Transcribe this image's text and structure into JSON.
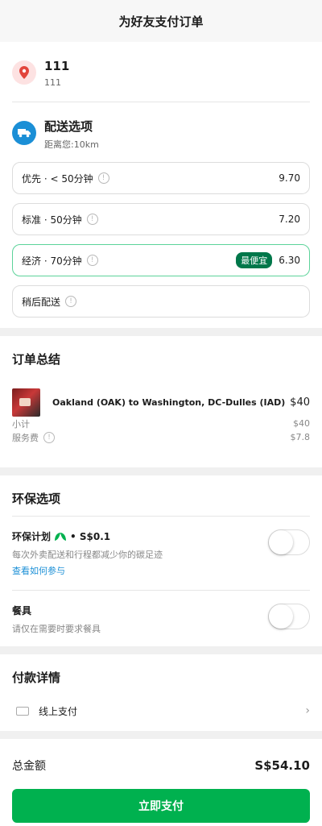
{
  "header": {
    "title": "为好友支付订单"
  },
  "address": {
    "name": "111",
    "detail": "111"
  },
  "delivery": {
    "title": "配送选项",
    "distance": "距离您:10km",
    "options": [
      {
        "label": "优先 · < 50分钟",
        "price": "9.70"
      },
      {
        "label": "标准 · 50分钟",
        "price": "7.20"
      },
      {
        "label": "经济 · 70分钟",
        "price": "6.30",
        "badge": "最便宜"
      },
      {
        "label": "稍后配送"
      }
    ]
  },
  "order": {
    "title": "订单总结",
    "item_name": "Oakland (OAK) to Washington, DC-Dulles (IAD)",
    "item_price": "$40",
    "subtotal_label": "小计",
    "subtotal_value": "$40",
    "fee_label": "服务费",
    "fee_value": "$7.8"
  },
  "eco": {
    "title": "环保选项",
    "plan_title": "环保计划",
    "plan_price": "• S$0.1",
    "plan_desc": "每次外卖配送和行程都减少你的碳足迹",
    "plan_link": "查看如何参与",
    "cutlery_title": "餐具",
    "cutlery_desc": "请仅在需要时要求餐具"
  },
  "payment": {
    "title": "付款详情",
    "method": "线上支付"
  },
  "total": {
    "label": "总金额",
    "value": "S$54.10",
    "button": "立即支付"
  },
  "colors": {
    "brand": "#00b14f",
    "badge": "#00774a",
    "link": "#1b8fd6"
  }
}
